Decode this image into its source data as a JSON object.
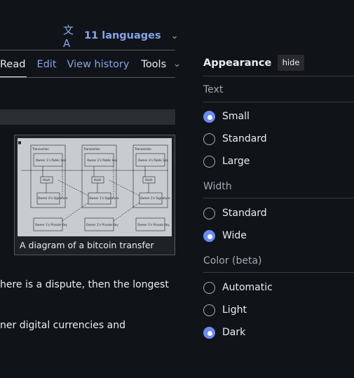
{
  "languages": {
    "icon": "translate-icon",
    "label": "11 languages",
    "chevron": "chevron-down-icon"
  },
  "tabs": {
    "read": "Read",
    "edit": "Edit",
    "history": "View history",
    "tools": "Tools"
  },
  "figure": {
    "caption": "A diagram of a bitcoin transfer",
    "diagram": {
      "transaction_label": "Transaction",
      "public_keys": [
        "Owner 1's Public key",
        "Owner 2's Public key",
        "Owner 3's Public key"
      ],
      "hash_label": "Hash",
      "signatures": [
        "Owner 0's Signature",
        "Owner 1's Signature",
        "Owner 2's Signature"
      ],
      "private_keys": [
        "Owner 1's Private Key",
        "Owner 2's Private Key",
        "Owner 3's Private Key"
      ]
    }
  },
  "article": {
    "line1": "here is a dispute, then the longest",
    "line2": "ner digital currencies and"
  },
  "appearance": {
    "title": "Appearance",
    "hide_label": "hide",
    "text": {
      "heading": "Text",
      "options": [
        "Small",
        "Standard",
        "Large"
      ],
      "selected": "Small"
    },
    "width": {
      "heading": "Width",
      "options": [
        "Standard",
        "Wide"
      ],
      "selected": "Wide"
    },
    "color": {
      "heading": "Color (beta)",
      "options": [
        "Automatic",
        "Light",
        "Dark"
      ],
      "selected": "Dark"
    }
  },
  "colors": {
    "background": "#101418",
    "link": "#88a3e8",
    "radio_selected": "#6d8af0",
    "text": "#eaecf0"
  }
}
